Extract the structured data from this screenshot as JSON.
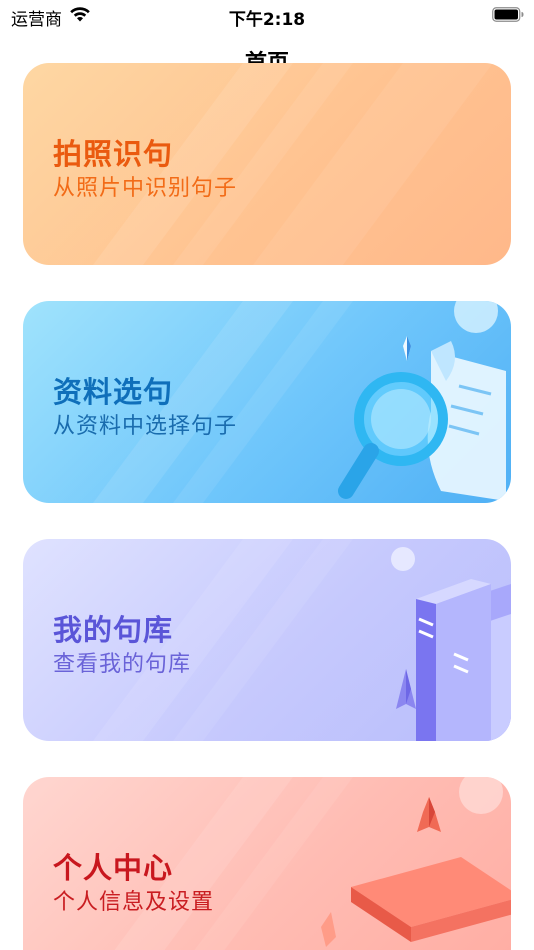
{
  "status_bar": {
    "carrier": "运营商",
    "time": "下午2:18"
  },
  "header": {
    "title": "首页"
  },
  "cards": [
    {
      "title": "拍照识句",
      "subtitle": "从照片中识别句子",
      "icon": "camera-photo-card"
    },
    {
      "title": "资料选句",
      "subtitle": "从资料中选择句子",
      "icon": "magnifier-document-icon"
    },
    {
      "title": "我的句库",
      "subtitle": "查看我的句库",
      "icon": "books-icon"
    },
    {
      "title": "个人中心",
      "subtitle": "个人信息及设置",
      "icon": "graduation-cap-icon"
    }
  ],
  "colors": {
    "photo_title": "#ea5a0f",
    "material_title": "#0f6fba",
    "library_title": "#5a55d8",
    "profile_title": "#c8171e"
  }
}
